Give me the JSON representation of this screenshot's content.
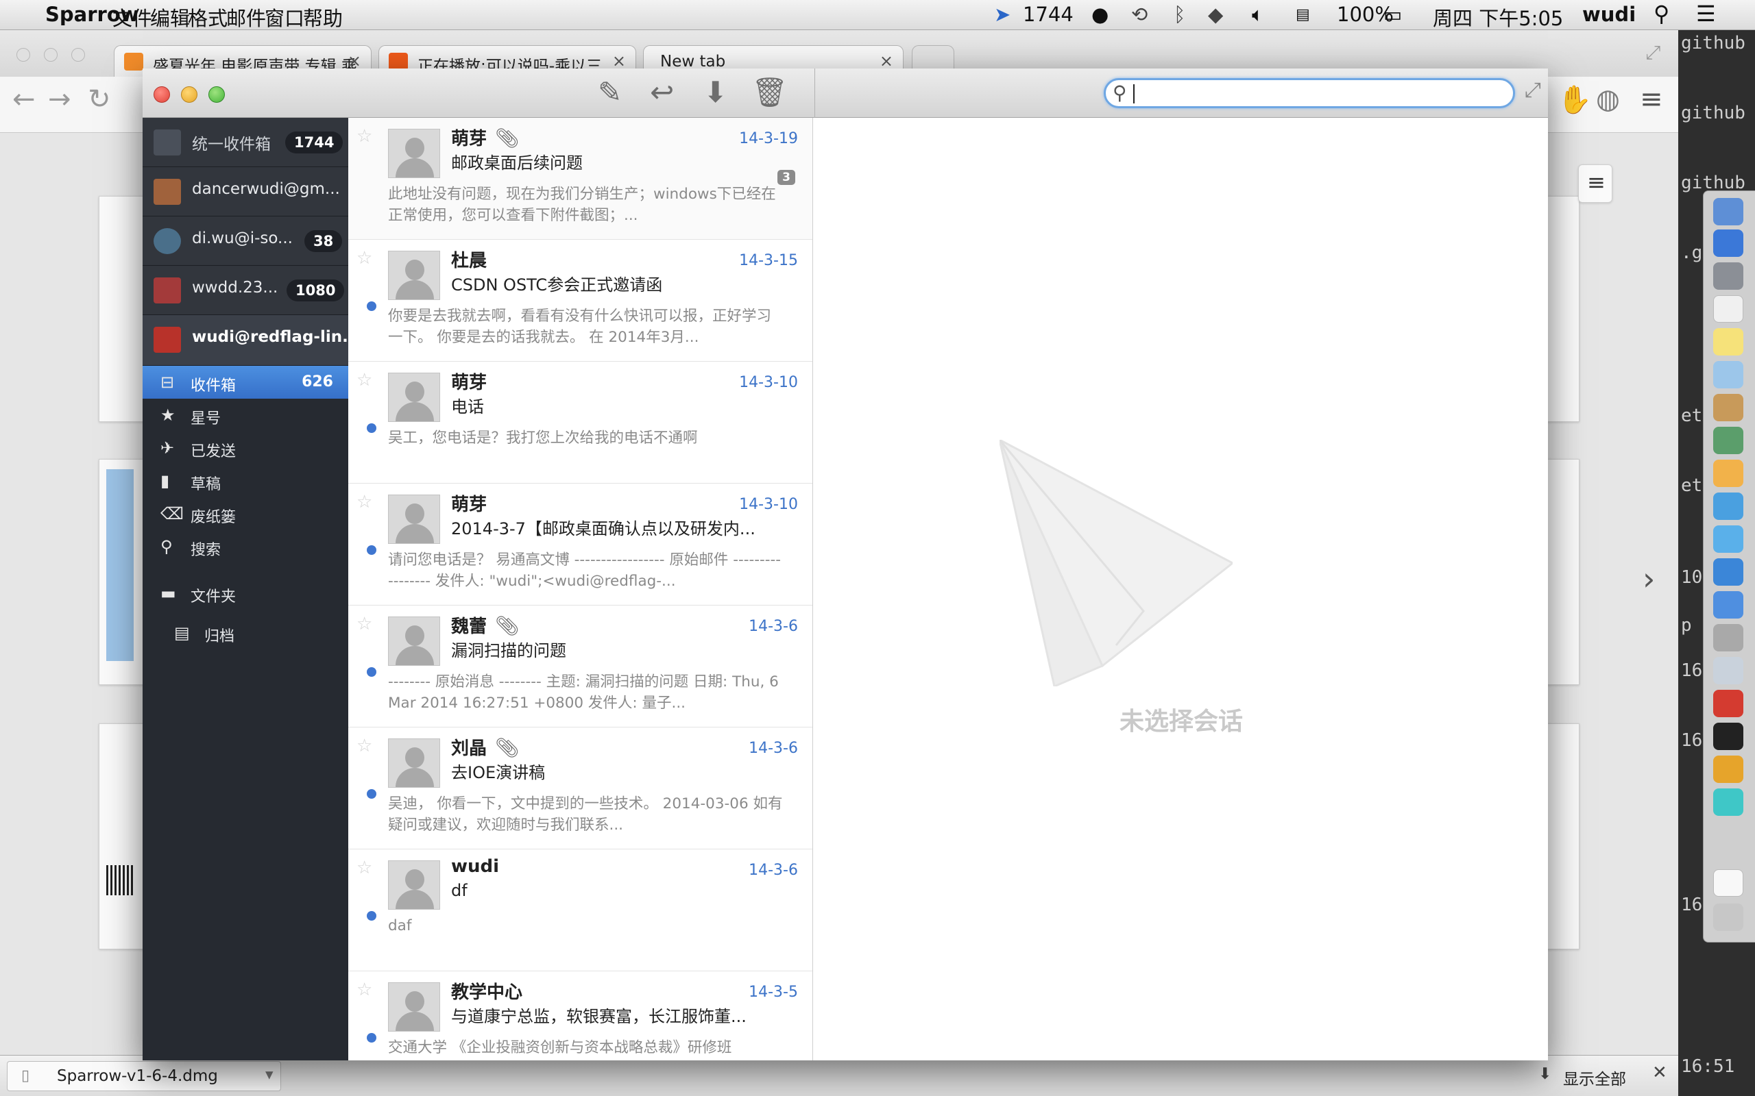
{
  "menubar": {
    "app": "Sparrow",
    "menus": [
      "文件",
      "编辑",
      "格式",
      "邮件",
      "窗口",
      "帮助"
    ],
    "sparrow_count": "1744",
    "battery": "100%",
    "clock": "周四 下午5:05",
    "user": "wudi"
  },
  "terminal": {
    "lines": [
      "github",
      "github",
      "github",
      ".g",
      "et",
      "et",
      "10",
      "p",
      "16",
      "16",
      "16",
      "16:51"
    ]
  },
  "browser": {
    "tabs": [
      {
        "title": "盛夏光年 电影原声带 专辑 乘"
      },
      {
        "title": "正在播放:可以说吗-乘以三"
      },
      {
        "title": "New tab"
      }
    ],
    "download": {
      "file": "Sparrow-v1-6-4.dmg",
      "show_all": "显示全部"
    }
  },
  "sparrow": {
    "accounts": [
      {
        "name": "统一收件箱",
        "count": "1744"
      },
      {
        "name": "dancerwudi@gm...",
        "count": ""
      },
      {
        "name": "di.wu@i-so...",
        "count": "38"
      },
      {
        "name": "wwdd.23...",
        "count": "1080"
      },
      {
        "name": "wudi@redflag-lin...",
        "count": ""
      }
    ],
    "folders": [
      {
        "label": "收件箱",
        "count": "626",
        "icon": "inbox-icon"
      },
      {
        "label": "星号",
        "count": "",
        "icon": "star-icon"
      },
      {
        "label": "已发送",
        "count": "",
        "icon": "sent-icon"
      },
      {
        "label": "草稿",
        "count": "",
        "icon": "draft-icon"
      },
      {
        "label": "废纸篓",
        "count": "",
        "icon": "trash-icon"
      },
      {
        "label": "搜索",
        "count": "",
        "icon": "search-icon"
      }
    ],
    "folders_header": "文件夹",
    "archive": "归档",
    "messages": [
      {
        "from": "萌芽",
        "attach": true,
        "date": "14-3-19",
        "subject": "邮政桌面后续问题",
        "preview": "此地址没有问题，现在为我们分销生产；windows下已经在正常使用，您可以查看下附件截图；...",
        "unread": false,
        "thread": "3"
      },
      {
        "from": "杜晨",
        "attach": false,
        "date": "14-3-15",
        "subject": "CSDN OSTC参会正式邀请函",
        "preview": "你要是去我就去啊，看看有没有什么快讯可以报，正好学习一下。 你要是去的话我就去。 在 2014年3月...",
        "unread": true,
        "thread": ""
      },
      {
        "from": "萌芽",
        "attach": false,
        "date": "14-3-10",
        "subject": "电话",
        "preview": "吴工，您电话是？我打您上次给我的电话不通啊",
        "unread": true,
        "thread": ""
      },
      {
        "from": "萌芽",
        "attach": false,
        "date": "14-3-10",
        "subject": "2014-3-7【邮政桌面确认点以及研发内...",
        "preview": "请问您电话是？ 易通高文博 ----------------- 原始邮件 ----------------- 发件人: \"wudi\";<wudi@redflag-...",
        "unread": true,
        "thread": ""
      },
      {
        "from": "魏蕾",
        "attach": true,
        "date": "14-3-6",
        "subject": "漏洞扫描的问题",
        "preview": "-------- 原始消息 -------- 主题: 漏洞扫描的问题 日期: Thu, 6 Mar 2014 16:27:51 +0800 发件人: 量子...",
        "unread": true,
        "thread": ""
      },
      {
        "from": "刘晶",
        "attach": true,
        "date": "14-3-6",
        "subject": "去IOE演讲稿",
        "preview": "吴迪， 你看一下，文中提到的一些技术。 2014-03-06 如有疑问或建议，欢迎随时与我们联系...",
        "unread": true,
        "thread": ""
      },
      {
        "from": "wudi",
        "attach": false,
        "date": "14-3-6",
        "subject": "df",
        "preview": "daf",
        "unread": true,
        "thread": ""
      },
      {
        "from": "教学中心",
        "attach": false,
        "date": "14-3-5",
        "subject": "与道康宁总监，软银赛富，长江服饰董...",
        "preview": "交通大学 《企业投融资创新与资本战略总裁》研修班",
        "unread": true,
        "thread": ""
      }
    ],
    "empty_text": "未选择会话",
    "search_placeholder": ""
  },
  "colors": {
    "accent": "#3a7bd5",
    "sidebar": "#262a31",
    "date": "#3c73c8"
  }
}
